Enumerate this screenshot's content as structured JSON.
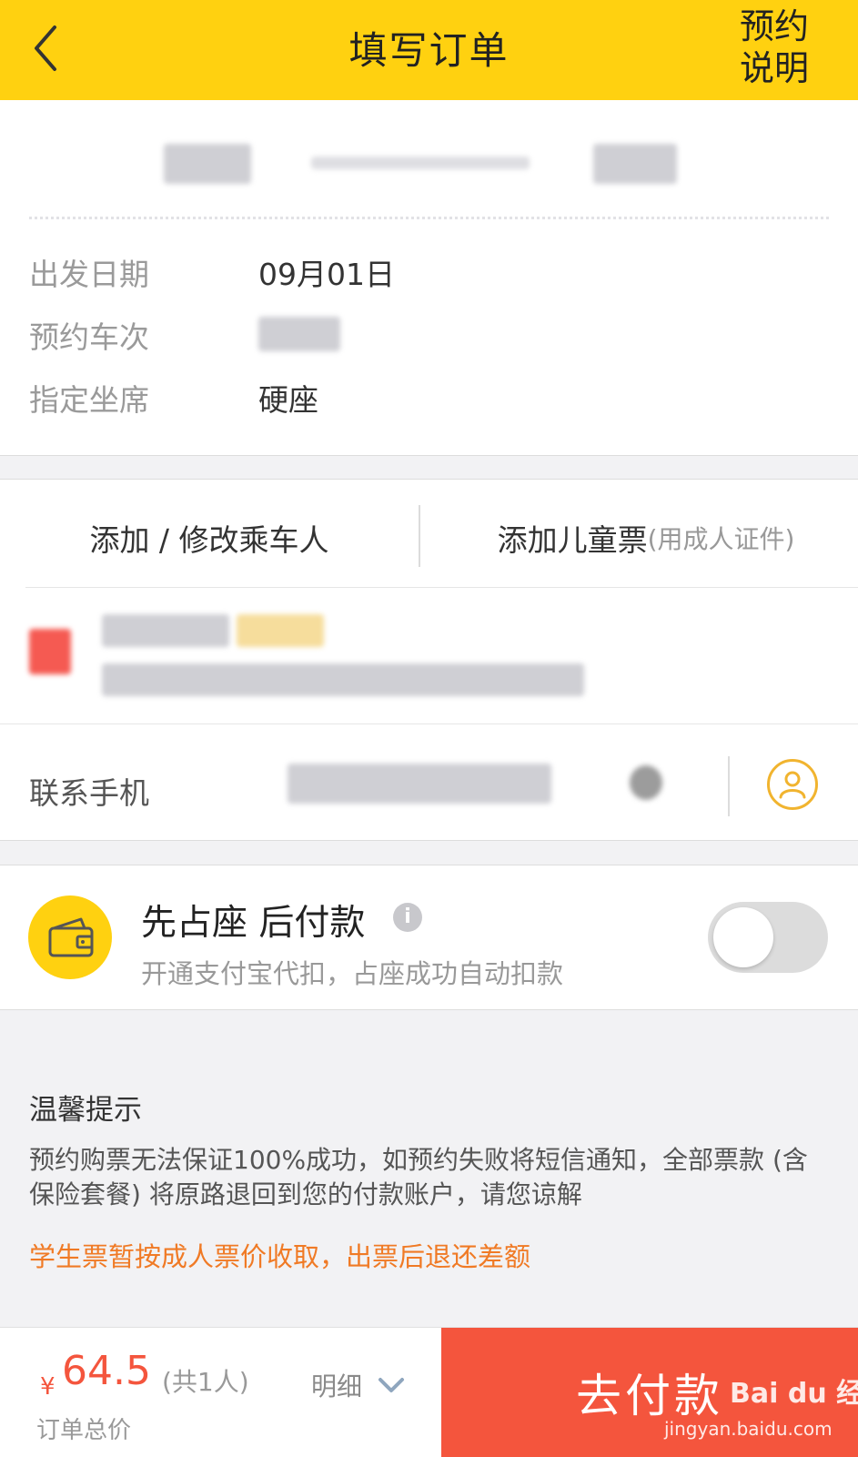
{
  "header": {
    "title": "填写订单",
    "help_line1": "预约",
    "help_line2": "说明"
  },
  "trip": {
    "rows": [
      {
        "label": "出发日期",
        "value": "09月01日"
      },
      {
        "label": "预约车次",
        "value": ""
      },
      {
        "label": "指定坐席",
        "value": "硬座"
      }
    ]
  },
  "passengers": {
    "add_edit_label": "添加 / 修改乘车人",
    "add_child_label": "添加儿童票",
    "add_child_note": "(用成人证件)"
  },
  "contact": {
    "label": "联系手机"
  },
  "pay_later": {
    "title": "先占座 后付款",
    "info_glyph": "i",
    "description": "开通支付宝代扣，占座成功自动扣款",
    "enabled": false
  },
  "tips": {
    "title": "温馨提示",
    "text": "预约购票无法保证100%成功，如预约失败将短信通知，全部票款 (含保险套餐) 将原路退回到您的付款账户，请您谅解",
    "warning": "学生票暂按成人票价收取，出票后退还差额"
  },
  "footer": {
    "currency": "¥",
    "amount": "64.5",
    "count": "(共1人)",
    "total_label": "订单总价",
    "detail_label": "明细",
    "pay_label": "去付款"
  },
  "watermark": {
    "logo": "Bai du 经验",
    "url": "jingyan.baidu.com"
  },
  "colors": {
    "header_bg": "#ffd110",
    "pay_button": "#f4553d",
    "warning": "#f07a25",
    "contact_icon": "#f1b42f"
  }
}
